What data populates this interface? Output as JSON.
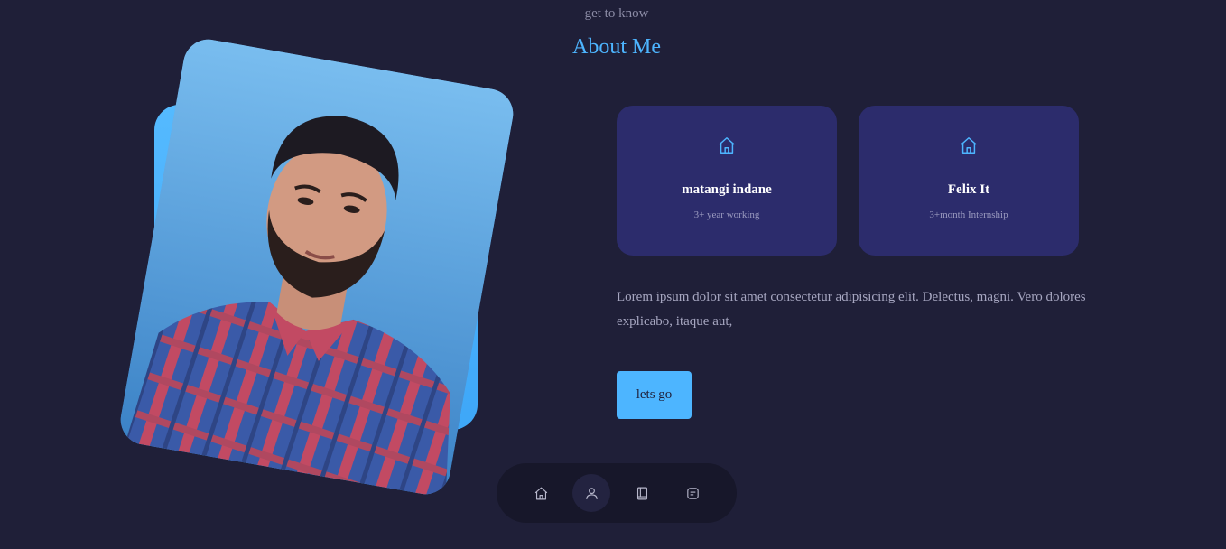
{
  "header": {
    "subtitle": "get to know",
    "title": "About Me"
  },
  "profile_photo": {
    "alt": "Portrait photo"
  },
  "cards": [
    {
      "icon": "home-icon",
      "title": "matangi indane",
      "subtitle": "3+ year working"
    },
    {
      "icon": "home-icon",
      "title": "Felix It",
      "subtitle": "3+month Internship"
    }
  ],
  "about": {
    "text": "Lorem ipsum dolor sit amet consectetur adipisicing elit. Delectus, magni. Vero dolores explicabo, itaque aut,"
  },
  "cta": {
    "label": "lets go"
  },
  "nav": {
    "items": [
      {
        "icon": "home-icon",
        "active": false
      },
      {
        "icon": "user-icon",
        "active": true
      },
      {
        "icon": "book-icon",
        "active": false
      },
      {
        "icon": "message-icon",
        "active": false
      }
    ]
  },
  "colors": {
    "background": "#1f1f38",
    "accent": "#4db5ff",
    "card": "#2c2c6c",
    "nav": "#17172a"
  }
}
